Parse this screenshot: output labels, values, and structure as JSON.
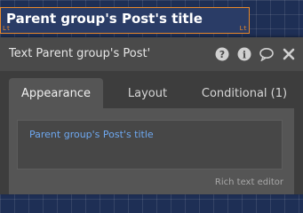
{
  "canvas_element": {
    "text": "Parent group's Post's title",
    "handle_left": "Lt",
    "handle_right": "Lt"
  },
  "panel": {
    "title": "Text Parent group's Post'",
    "header_icons": [
      "help-icon",
      "info-icon",
      "comment-icon",
      "close-icon"
    ],
    "tabs": [
      {
        "label": "Appearance",
        "active": true
      },
      {
        "label": "Layout",
        "active": false
      },
      {
        "label": "Conditional (1)",
        "active": false
      }
    ],
    "content_expression": "Parent group's Post's title",
    "rich_text_label": "Rich text editor"
  },
  "colors": {
    "canvas_bg": "#1e2f55",
    "selection_border": "#e8892b",
    "dynamic_expression": "#6ea8f0"
  }
}
